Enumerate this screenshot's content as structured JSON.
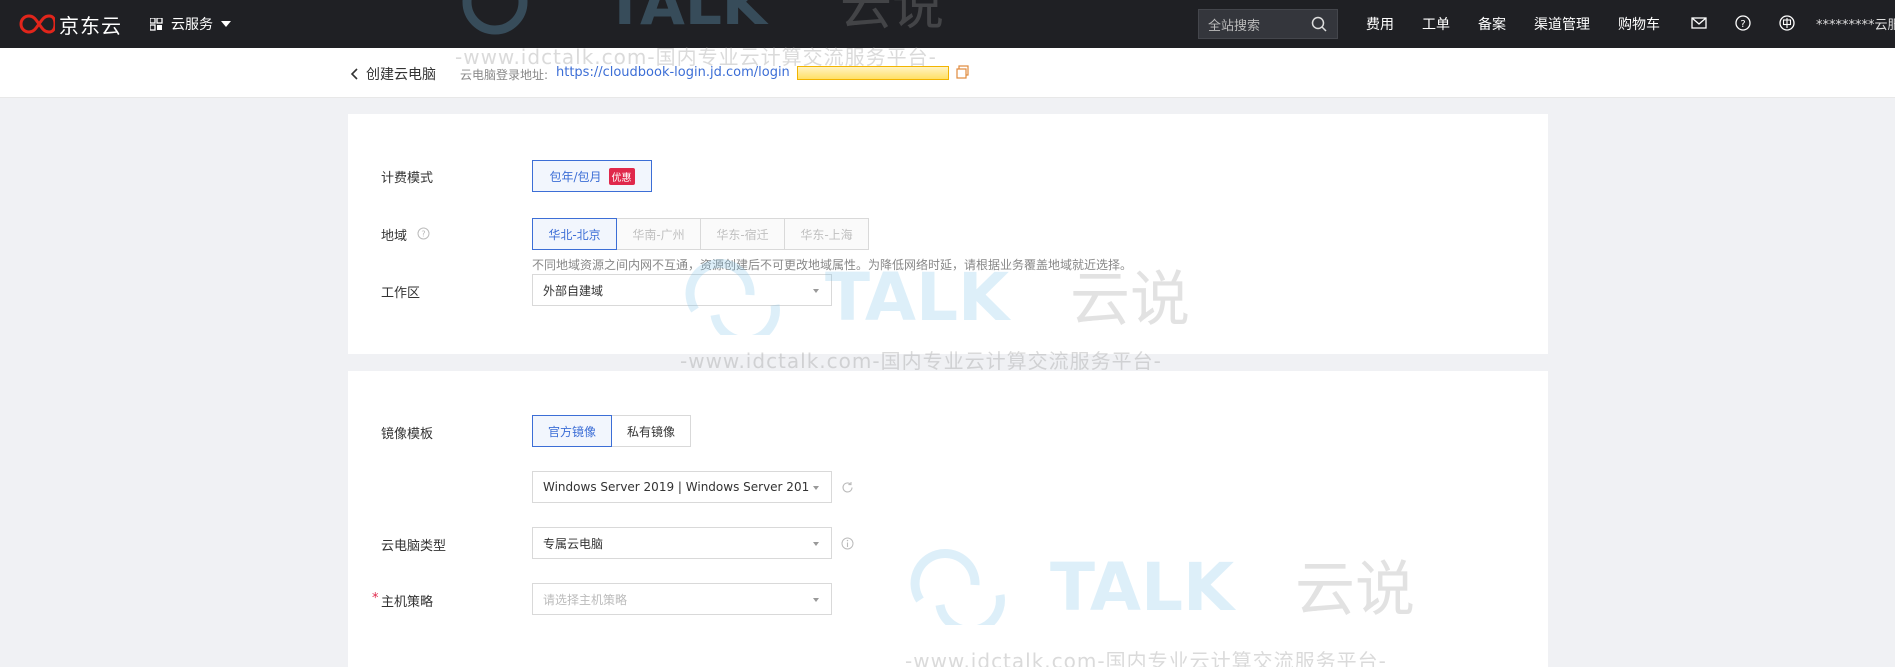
{
  "topnav": {
    "logo_text": "京东云",
    "service_menu": "云服务",
    "search_placeholder": "全站搜索",
    "links": [
      "费用",
      "工单",
      "备案",
      "渠道管理",
      "购物车"
    ],
    "user": "*********云服务..."
  },
  "subbar": {
    "back_label": "创建云电脑",
    "login_label": "云电脑登录地址:",
    "login_url": "https://cloudbook-login.jd.com/login"
  },
  "form": {
    "billing": {
      "label": "计费模式",
      "option": "包年/包月",
      "badge": "优惠"
    },
    "region": {
      "label": "地域",
      "options": [
        "华北-北京",
        "华南-广州",
        "华东-宿迁",
        "华东-上海"
      ],
      "hint": "不同地域资源之间内网不互通，资源创建后不可更改地域属性。为降低网络时延，请根据业务覆盖地域就近选择。"
    },
    "workspace": {
      "label": "工作区",
      "value": "外部自建域"
    },
    "image": {
      "label": "镜像模板",
      "tabs": [
        "官方镜像",
        "私有镜像"
      ],
      "value": "Windows Server 2019 | Windows Server 201"
    },
    "type": {
      "label": "云电脑类型",
      "value": "专属云电脑"
    },
    "policy": {
      "label": "主机策略",
      "required": "*",
      "placeholder": "请选择主机策略"
    }
  },
  "watermark": {
    "brand": "TALK 云说",
    "tagline": "-www.idctalk.com-国内专业云计算交流服务平台-"
  },
  "colors": {
    "accent": "#3c6ed6",
    "nav_bg": "#1f2024",
    "brand_red": "#e1251b",
    "badge_red": "#e0284b"
  }
}
